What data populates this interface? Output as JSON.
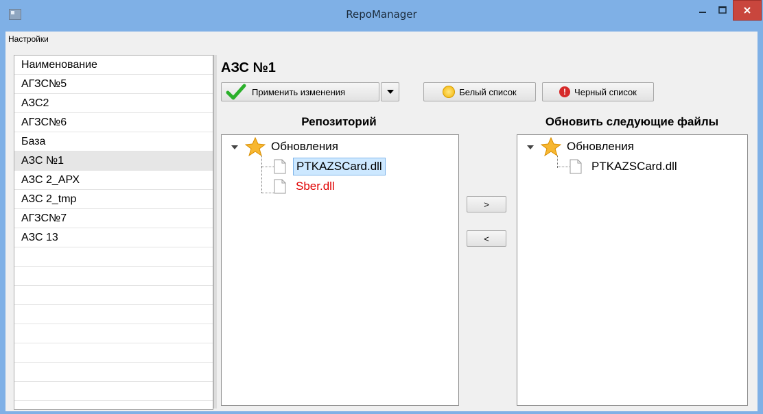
{
  "window": {
    "title": "RepoManager",
    "minimize_icon": "minimize-icon",
    "maximize_icon": "maximize-icon",
    "close_icon": "close-icon"
  },
  "menu": {
    "items": [
      {
        "label": "Настройки"
      }
    ]
  },
  "station_list": {
    "header": "Наименование",
    "items": [
      {
        "label": "АГЗС№5"
      },
      {
        "label": "АЗС2"
      },
      {
        "label": "АГЗС№6"
      },
      {
        "label": "База"
      },
      {
        "label": "АЗС №1",
        "selected": true
      },
      {
        "label": "АЗС 2_АРХ"
      },
      {
        "label": "АЗС 2_tmp"
      },
      {
        "label": "АГЗС№7"
      },
      {
        "label": "АЗС 13"
      }
    ]
  },
  "main": {
    "title": "АЗС №1",
    "toolbar": {
      "apply_label": "Применить изменения",
      "white_list_label": "Белый список",
      "black_list_label": "Черный список"
    },
    "repository": {
      "header": "Репозиторий",
      "root_label": "Обновления",
      "files": [
        {
          "label": "PTKAZSCard.dll",
          "selected": true,
          "color": "#000000"
        },
        {
          "label": "Sber.dll",
          "selected": false,
          "color": "#e00000"
        }
      ]
    },
    "move_buttons": {
      "add_label": ">",
      "remove_label": "<"
    },
    "update_files": {
      "header": "Обновить следующие файлы",
      "root_label": "Обновления",
      "files": [
        {
          "label": "PTKAZSCard.dll"
        }
      ]
    }
  },
  "colors": {
    "titlebar": "#7fb0e6",
    "close_button": "#c9463d",
    "selection": "#cde8ff",
    "red_text": "#e00000"
  }
}
